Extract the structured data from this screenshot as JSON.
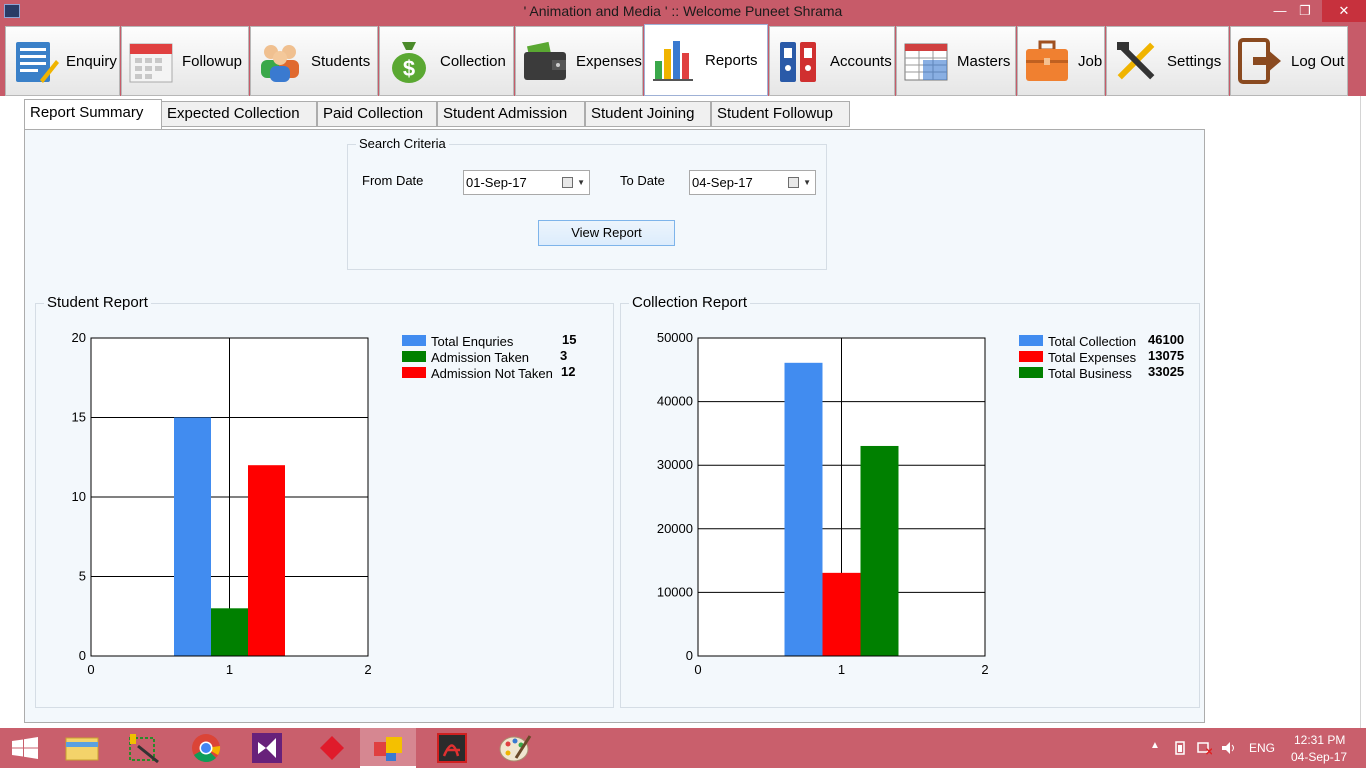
{
  "window": {
    "title": "' Animation and Media ' :: Welcome Puneet Shrama"
  },
  "toolbar": {
    "items": [
      {
        "label": "Enquiry",
        "icon": "enquiry-icon"
      },
      {
        "label": "Followup",
        "icon": "calendar-icon"
      },
      {
        "label": "Students",
        "icon": "students-icon"
      },
      {
        "label": "Collection",
        "icon": "money-bag-icon"
      },
      {
        "label": "Expenses",
        "icon": "wallet-icon"
      },
      {
        "label": "Reports",
        "icon": "bar-chart-icon",
        "active": true
      },
      {
        "label": "Accounts",
        "icon": "binders-icon"
      },
      {
        "label": "Masters",
        "icon": "table-icon"
      },
      {
        "label": "Job",
        "icon": "briefcase-icon"
      },
      {
        "label": "Settings",
        "icon": "tools-icon"
      },
      {
        "label": "Log Out",
        "icon": "logout-icon"
      }
    ]
  },
  "tabs": [
    {
      "label": "Report Summary",
      "active": true
    },
    {
      "label": "Expected Collection"
    },
    {
      "label": "Paid Collection"
    },
    {
      "label": "Student Admission"
    },
    {
      "label": "Student Joining"
    },
    {
      "label": "Student Followup"
    }
  ],
  "search": {
    "group_label": "Search Criteria",
    "from_label": "From Date",
    "from_value": "01-Sep-17",
    "to_label": "To Date",
    "to_value": "04-Sep-17",
    "button_label": "View Report"
  },
  "student_report": {
    "group_label": "Student Report"
  },
  "collection_report": {
    "group_label": "Collection Report"
  },
  "chart_data": [
    {
      "type": "bar",
      "title": "Student Report",
      "x": [
        0,
        1,
        2
      ],
      "xlim": [
        0,
        2
      ],
      "ylim": [
        0,
        20
      ],
      "yticks": [
        0,
        5,
        10,
        15,
        20
      ],
      "xticks": [
        0,
        1,
        2
      ],
      "grid": true,
      "legend_position": "right",
      "series": [
        {
          "name": "Total Enquries",
          "value": 15,
          "value_label": "15",
          "color": "#418cf0"
        },
        {
          "name": "Admission Taken",
          "value": 3,
          "value_label": "3",
          "color": "#008000"
        },
        {
          "name": "Admission Not Taken",
          "value": 12,
          "value_label": "12",
          "color": "#ff0000"
        }
      ]
    },
    {
      "type": "bar",
      "title": "Collection Report",
      "x": [
        0,
        1,
        2
      ],
      "xlim": [
        0,
        2
      ],
      "ylim": [
        0,
        50000
      ],
      "yticks": [
        0,
        10000,
        20000,
        30000,
        40000,
        50000
      ],
      "xticks": [
        0,
        1,
        2
      ],
      "grid": true,
      "legend_position": "right",
      "series": [
        {
          "name": "Total Collection",
          "value": 46100,
          "value_label": "46100",
          "color": "#418cf0"
        },
        {
          "name": "Total Expenses",
          "value": 13075,
          "value_label": "13075",
          "color": "#ff0000"
        },
        {
          "name": "Total Business",
          "value": 33025,
          "value_label": "33025",
          "color": "#008000"
        }
      ]
    }
  ],
  "taskbar": {
    "apps": [
      {
        "icon": "windows-start-icon"
      },
      {
        "icon": "file-explorer-icon"
      },
      {
        "icon": "snipping-tool-icon"
      },
      {
        "icon": "chrome-icon"
      },
      {
        "icon": "visual-studio-icon"
      },
      {
        "icon": "red-diamond-app-icon"
      },
      {
        "icon": "winforms-app-icon",
        "active": true
      },
      {
        "icon": "acrobat-icon"
      },
      {
        "icon": "paint-icon"
      }
    ],
    "language": "ENG",
    "time": "12:31 PM",
    "date": "04-Sep-17"
  },
  "colors": {
    "chrome": "#c75b69",
    "tabpage_bg": "#f3f8fc",
    "button_border": "#7eb4ea"
  }
}
